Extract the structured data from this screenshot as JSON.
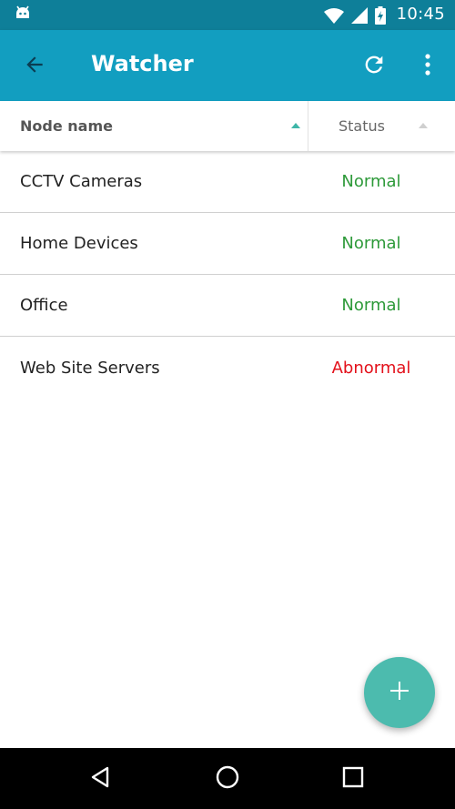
{
  "status_bar": {
    "time": "10:45",
    "icons": [
      "android-icon",
      "wifi-icon",
      "signal-icon",
      "battery-charging-icon"
    ]
  },
  "app_bar": {
    "title": "Watcher",
    "color": "#129ec0",
    "icons": [
      "back-arrow-icon",
      "refresh-icon",
      "more-vert-icon"
    ]
  },
  "table": {
    "columns": [
      {
        "label": "Node name",
        "sort": "ascending"
      },
      {
        "label": "Status",
        "sort": "inactive"
      }
    ],
    "rows": [
      {
        "name": "CCTV Cameras",
        "status": "Normal",
        "status_color": "#2e9a3a"
      },
      {
        "name": "Home Devices",
        "status": "Normal",
        "status_color": "#2e9a3a"
      },
      {
        "name": "Office",
        "status": "Normal",
        "status_color": "#2e9a3a"
      },
      {
        "name": "Web Site Servers",
        "status": "Abnormal",
        "status_color": "#e3111b"
      }
    ]
  },
  "fab": {
    "icon": "plus-icon",
    "color": "#4cbbae"
  },
  "nav_bar": {
    "icons": [
      "nav-back-icon",
      "nav-home-icon",
      "nav-recents-icon"
    ]
  }
}
